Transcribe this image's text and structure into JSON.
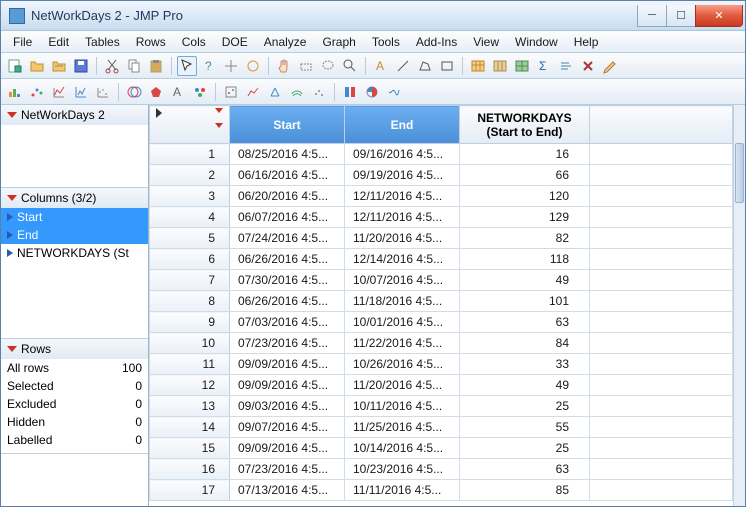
{
  "window": {
    "title": "NetWorkDays 2 - JMP Pro"
  },
  "menu": [
    "File",
    "Edit",
    "Tables",
    "Rows",
    "Cols",
    "DOE",
    "Analyze",
    "Graph",
    "Tools",
    "Add-Ins",
    "View",
    "Window",
    "Help"
  ],
  "leftTop": {
    "title": "NetWorkDays 2"
  },
  "columnsPane": {
    "title": "Columns (3/2)",
    "items": [
      {
        "label": "Start",
        "sel": true
      },
      {
        "label": "End",
        "sel": true
      },
      {
        "label": "NETWORKDAYS (St",
        "sel": false
      }
    ]
  },
  "rowsPane": {
    "title": "Rows",
    "stats": [
      {
        "label": "All rows",
        "value": "100"
      },
      {
        "label": "Selected",
        "value": "0"
      },
      {
        "label": "Excluded",
        "value": "0"
      },
      {
        "label": "Hidden",
        "value": "0"
      },
      {
        "label": "Labelled",
        "value": "0"
      }
    ]
  },
  "table": {
    "headers": {
      "start": "Start",
      "end": "End",
      "nwd_l1": "NETWORKDAYS",
      "nwd_l2": "(Start to End)"
    },
    "rows": [
      {
        "n": "1",
        "start": "08/25/2016 4:5...",
        "end": "09/16/2016 4:5...",
        "nwd": "16"
      },
      {
        "n": "2",
        "start": "06/16/2016 4:5...",
        "end": "09/19/2016 4:5...",
        "nwd": "66"
      },
      {
        "n": "3",
        "start": "06/20/2016 4:5...",
        "end": "12/11/2016 4:5...",
        "nwd": "120"
      },
      {
        "n": "4",
        "start": "06/07/2016 4:5...",
        "end": "12/11/2016 4:5...",
        "nwd": "129"
      },
      {
        "n": "5",
        "start": "07/24/2016 4:5...",
        "end": "11/20/2016 4:5...",
        "nwd": "82"
      },
      {
        "n": "6",
        "start": "06/26/2016 4:5...",
        "end": "12/14/2016 4:5...",
        "nwd": "118"
      },
      {
        "n": "7",
        "start": "07/30/2016 4:5...",
        "end": "10/07/2016 4:5...",
        "nwd": "49"
      },
      {
        "n": "8",
        "start": "06/26/2016 4:5...",
        "end": "11/18/2016 4:5...",
        "nwd": "101"
      },
      {
        "n": "9",
        "start": "07/03/2016 4:5...",
        "end": "10/01/2016 4:5...",
        "nwd": "63"
      },
      {
        "n": "10",
        "start": "07/23/2016 4:5...",
        "end": "11/22/2016 4:5...",
        "nwd": "84"
      },
      {
        "n": "11",
        "start": "09/09/2016 4:5...",
        "end": "10/26/2016 4:5...",
        "nwd": "33"
      },
      {
        "n": "12",
        "start": "09/09/2016 4:5...",
        "end": "11/20/2016 4:5...",
        "nwd": "49"
      },
      {
        "n": "13",
        "start": "09/03/2016 4:5...",
        "end": "10/11/2016 4:5...",
        "nwd": "25"
      },
      {
        "n": "14",
        "start": "09/07/2016 4:5...",
        "end": "11/25/2016 4:5...",
        "nwd": "55"
      },
      {
        "n": "15",
        "start": "09/09/2016 4:5...",
        "end": "10/14/2016 4:5...",
        "nwd": "25"
      },
      {
        "n": "16",
        "start": "07/23/2016 4:5...",
        "end": "10/23/2016 4:5...",
        "nwd": "63"
      },
      {
        "n": "17",
        "start": "07/13/2016 4:5...",
        "end": "11/11/2016 4:5...",
        "nwd": "85"
      }
    ]
  }
}
